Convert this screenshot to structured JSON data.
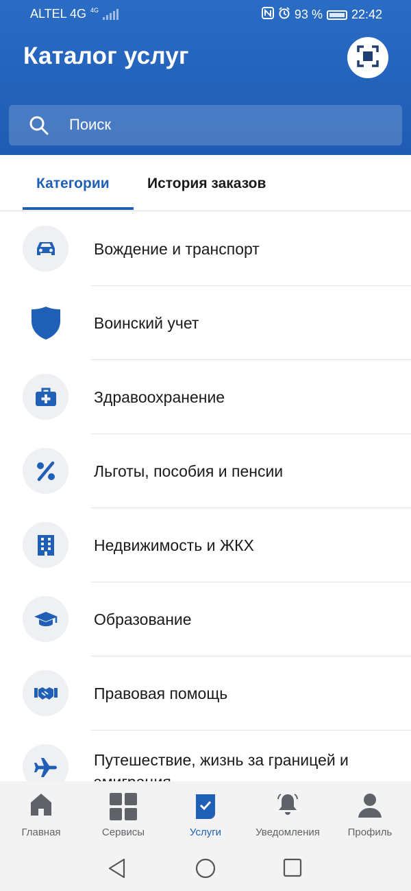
{
  "status_bar": {
    "carrier": "ALTEL 4G",
    "network_badge": "4G",
    "battery": "93 %",
    "time": "22:42"
  },
  "header": {
    "title": "Каталог услуг",
    "scan_icon": "qr-scan-icon"
  },
  "search": {
    "placeholder": "Поиск"
  },
  "tabs": [
    {
      "label": "Категории",
      "active": true
    },
    {
      "label": "История заказов",
      "active": false
    }
  ],
  "categories": [
    {
      "label": "Вождение и транспорт",
      "icon": "car-icon"
    },
    {
      "label": "Воинский учет",
      "icon": "shield-icon"
    },
    {
      "label": "Здравоохранение",
      "icon": "medical-kit-icon"
    },
    {
      "label": "Льготы, пособия и пенсии",
      "icon": "percent-icon"
    },
    {
      "label": "Недвижимость и ЖКХ",
      "icon": "building-icon"
    },
    {
      "label": "Образование",
      "icon": "graduation-cap-icon"
    },
    {
      "label": "Правовая помощь",
      "icon": "handshake-icon"
    },
    {
      "label": "Путешествие, жизнь за границей и эмиграция",
      "icon": "airplane-icon"
    }
  ],
  "bottom_nav": [
    {
      "label": "Главная",
      "icon": "home-icon",
      "active": false
    },
    {
      "label": "Сервисы",
      "icon": "grid-icon",
      "active": false
    },
    {
      "label": "Услуги",
      "icon": "services-check-icon",
      "active": true
    },
    {
      "label": "Уведомления",
      "icon": "bell-icon",
      "active": false
    },
    {
      "label": "Профиль",
      "icon": "profile-icon",
      "active": false
    }
  ],
  "colors": {
    "primary": "#1f5fb6",
    "header_bg": "#2a6cc4",
    "icon_plate": "#eef0f3",
    "nav_inactive": "#5f6368"
  }
}
